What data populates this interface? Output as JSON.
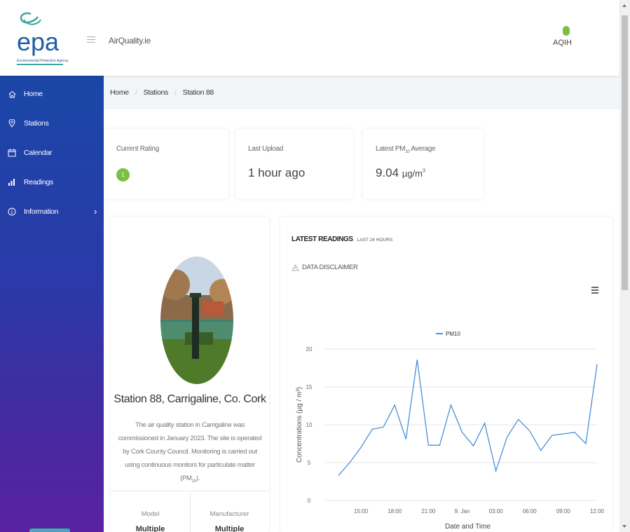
{
  "app": {
    "logo_text": "epa",
    "logo_subtext": "Environmental Protection Agency",
    "name": "AirQuality.ie",
    "aqih_label": "AQIH",
    "aqih_color": "#7ac143"
  },
  "sidebar": {
    "items": [
      {
        "label": "Home",
        "icon": "home-icon"
      },
      {
        "label": "Stations",
        "icon": "map-pin-icon"
      },
      {
        "label": "Calendar",
        "icon": "calendar-icon"
      },
      {
        "label": "Readings",
        "icon": "bar-chart-icon"
      },
      {
        "label": "Information",
        "icon": "info-icon",
        "chevron": "›"
      }
    ]
  },
  "breadcrumb": [
    "Home",
    "Stations",
    "Station 88"
  ],
  "summary": {
    "rating_label": "Current Rating",
    "rating_value": "1",
    "rating_color": "#7ac143",
    "upload_label": "Last Upload",
    "upload_value": "1 hour ago",
    "pm_label_prefix": "Latest PM",
    "pm_label_sub": "10",
    "pm_label_suffix": " Average",
    "pm_value": "9.04",
    "pm_unit": "µg/m",
    "pm_unit_sup": "3"
  },
  "station": {
    "title": "Station 88, Carrigaline, Co. Cork",
    "description": "The air quality station in Carrigaline was commissioned in January 2023. The site is operated by Cork County Council. Monitoring is carried out using continuous monitors for particulate matter (PM",
    "description_sub": "10",
    "description_end": ").",
    "model_label": "Model",
    "model_value": "Multiple",
    "manufacturer_label": "Manufacturer",
    "manufacturer_value": "Multiple"
  },
  "readings": {
    "heading": "LATEST READINGS",
    "subheading": "LAST 24 HOURS",
    "disclaimer": "DATA DISCLAIMER"
  },
  "chart_data": {
    "type": "line",
    "title": "",
    "xlabel": "Date and Time",
    "ylabel": "Concentrations (µg / m³)",
    "ylim": [
      0,
      20
    ],
    "yticks": [
      0,
      5,
      10,
      15,
      20
    ],
    "xtick_labels": [
      "15:00",
      "18:00",
      "21:00",
      "9. Jan",
      "03:00",
      "06:00",
      "09:00",
      "12:00"
    ],
    "legend_position": "top-center",
    "grid": true,
    "series": [
      {
        "name": "PM10",
        "color": "#4a90d9",
        "x": [
          "13:00",
          "14:00",
          "15:00",
          "16:00",
          "17:00",
          "18:00",
          "19:00",
          "20:00",
          "21:00",
          "22:00",
          "23:00",
          "00:00",
          "01:00",
          "02:00",
          "03:00",
          "04:00",
          "05:00",
          "06:00",
          "07:00",
          "08:00",
          "09:00",
          "10:00",
          "11:00",
          "12:00"
        ],
        "values": [
          3.3,
          5.0,
          7.0,
          9.4,
          9.7,
          12.6,
          8.1,
          18.6,
          7.3,
          7.3,
          12.6,
          9.0,
          7.2,
          10.2,
          3.9,
          8.4,
          10.7,
          9.2,
          6.6,
          8.6,
          8.8,
          9.0,
          7.5,
          18.0
        ]
      }
    ]
  }
}
